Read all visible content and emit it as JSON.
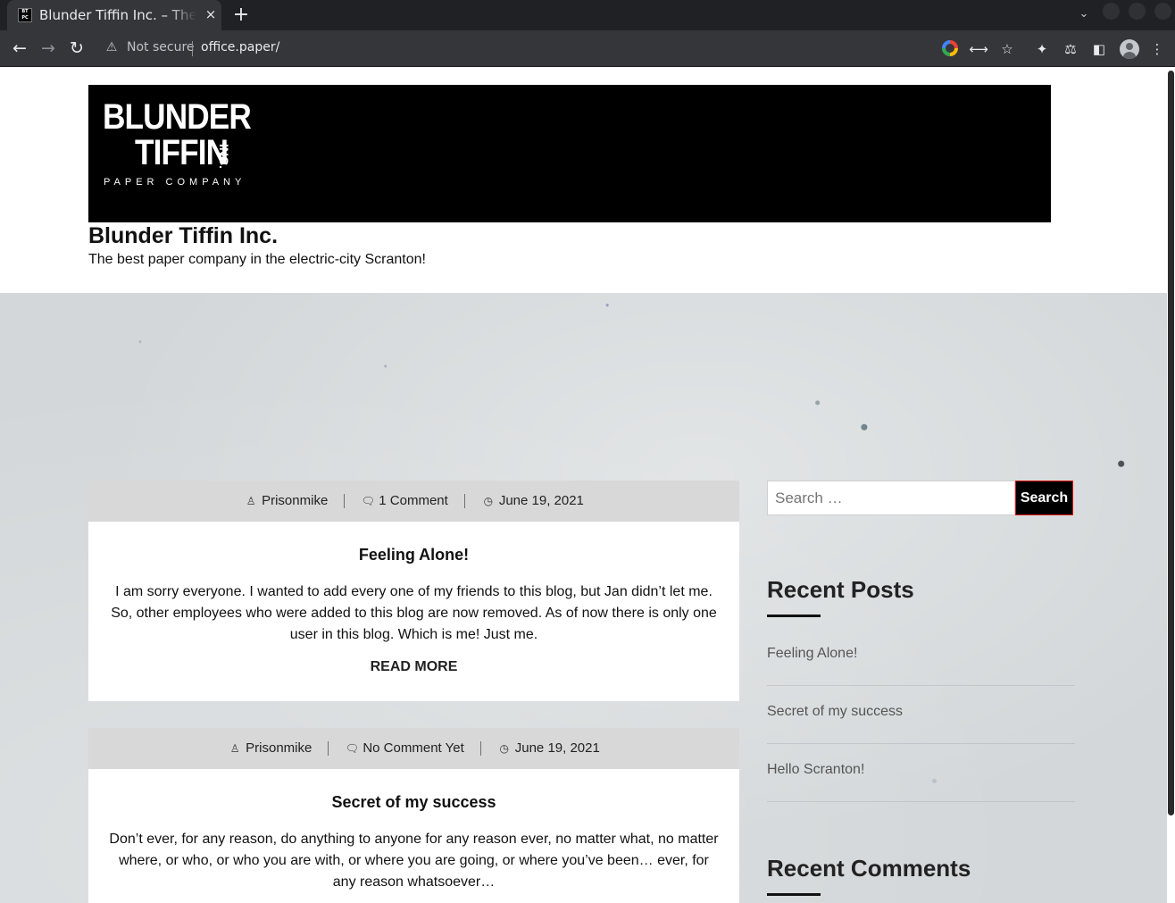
{
  "browser": {
    "tab_title": "Blunder Tiffin Inc. – The best paper company in the electric-city Scranton!",
    "tab_close": "×",
    "new_tab": "+",
    "tab_menu": "⌄",
    "security_label": "Not secure",
    "url": "office.paper/",
    "icons": [
      "back-icon",
      "forward-icon",
      "reload-icon",
      "warning-icon",
      "google-icon",
      "share-icon",
      "star-icon",
      "extensions-icon",
      "labs-icon",
      "sidepanel-icon",
      "profile-icon",
      "menu-icon"
    ]
  },
  "site": {
    "logo_line1": "BLUNDER",
    "logo_line2": "TIFFIN",
    "logo_inc": "INC.",
    "logo_sub": "PAPER COMPANY",
    "title": "Blunder Tiffin Inc.",
    "tagline": "The best paper company in the electric-city Scranton!"
  },
  "posts": [
    {
      "author": "Prisonmike",
      "comments": "1 Comment",
      "date": "June 19, 2021",
      "title": "Feeling Alone!",
      "excerpt": "I am sorry everyone. I wanted to add every one of my friends to this blog, but Jan didn’t let me. So, other employees who were added to this blog are now removed. As of now there is only one user in this blog. Which is me! Just me.",
      "read_more": "READ MORE"
    },
    {
      "author": "Prisonmike",
      "comments": "No Comment Yet",
      "date": "June 19, 2021",
      "title": "Secret of my success",
      "excerpt": "Don’t ever, for any reason, do anything to anyone for any reason ever, no matter what, no matter where, or who, or who you are with, or where you are going, or where you’ve been… ever, for any reason whatsoever…"
    }
  ],
  "sidebar": {
    "search_placeholder": "Search …",
    "search_button": "Search",
    "recent_posts_title": "Recent Posts",
    "recent_posts": [
      "Feeling Alone!",
      "Secret of my success",
      "Hello Scranton!"
    ],
    "recent_comments_title": "Recent Comments"
  },
  "colors": {
    "browser_tabbar": "#202124",
    "browser_toolbar": "#35363a",
    "logo_background": "#000000",
    "meta_bar": "#d8d8d8",
    "search_button_border": "#dd1111"
  }
}
